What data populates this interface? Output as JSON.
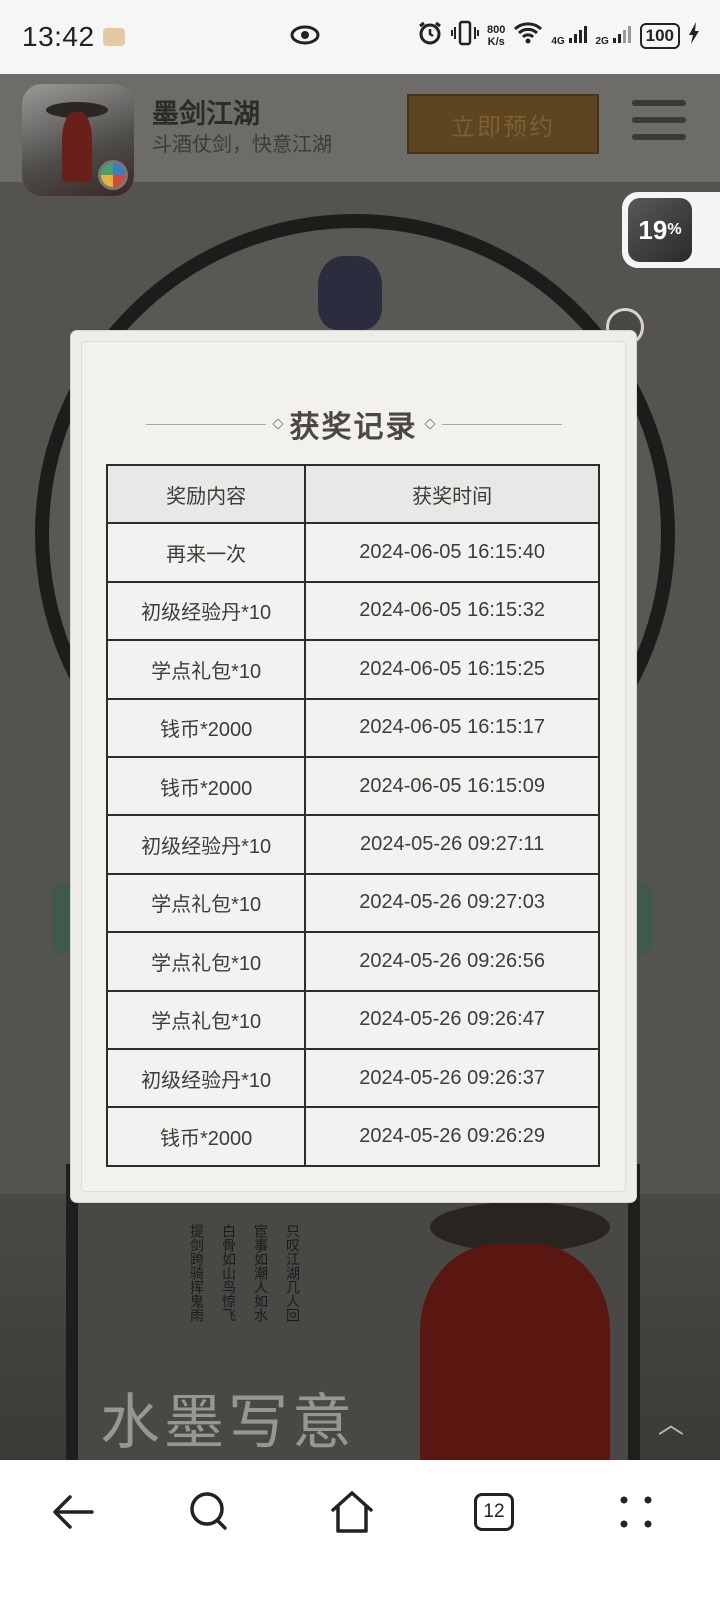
{
  "status_bar": {
    "time": "13:42",
    "net_speed_value": "800",
    "net_speed_unit": "K/s",
    "signal_1": "4G",
    "signal_2": "2G",
    "battery": "100"
  },
  "header": {
    "game_name": "墨剑江湖",
    "slogan": "斗酒仗剑，快意江湖",
    "reserve_button": "立即预约"
  },
  "float_widget": {
    "percent": "19",
    "unit": "%"
  },
  "modal": {
    "title": "获奖记录",
    "columns": [
      "奖励内容",
      "获奖时间"
    ],
    "rows": [
      {
        "reward": "再来一次",
        "time": "2024-06-05 16:15:40"
      },
      {
        "reward": "初级经验丹*10",
        "time": "2024-06-05 16:15:32"
      },
      {
        "reward": "学点礼包*10",
        "time": "2024-06-05 16:15:25"
      },
      {
        "reward": "钱币*2000",
        "time": "2024-06-05 16:15:17"
      },
      {
        "reward": "钱币*2000",
        "time": "2024-06-05 16:15:09"
      },
      {
        "reward": "初级经验丹*10",
        "time": "2024-05-26 09:27:11"
      },
      {
        "reward": "学点礼包*10",
        "time": "2024-05-26 09:27:03"
      },
      {
        "reward": "学点礼包*10",
        "time": "2024-05-26 09:26:56"
      },
      {
        "reward": "学点礼包*10",
        "time": "2024-05-26 09:26:47"
      },
      {
        "reward": "初级经验丹*10",
        "time": "2024-05-26 09:26:37"
      },
      {
        "reward": "钱币*2000",
        "time": "2024-05-26 09:26:29"
      }
    ]
  },
  "background_art": {
    "title": "水墨写意",
    "poem": "只叹江湖几人回 宦事如潮人如水 白骨如山鸟惊飞 提剑跨骑挥鬼雨"
  },
  "navbar": {
    "tab_count": "12"
  }
}
